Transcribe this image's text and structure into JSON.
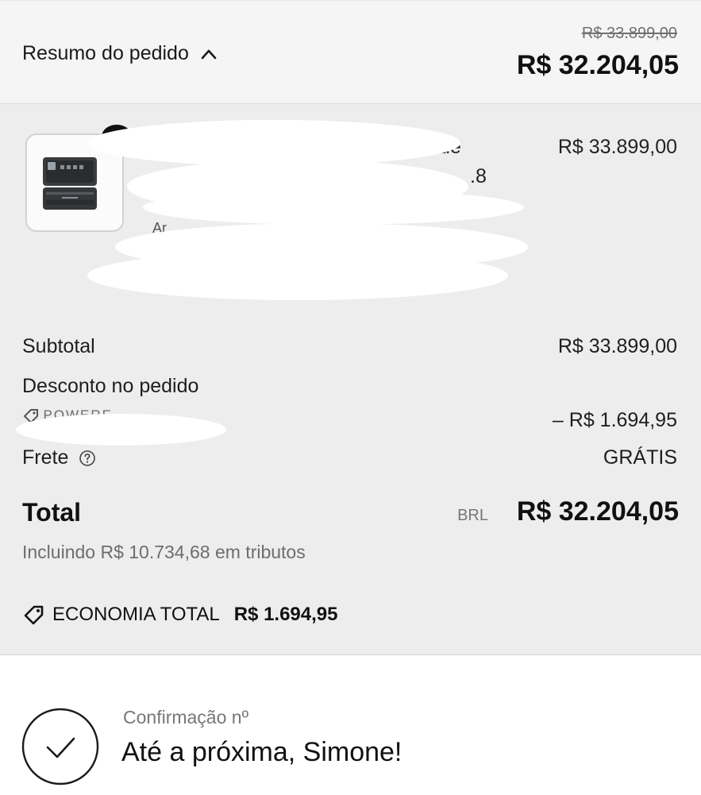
{
  "header": {
    "summary_label": "Resumo do pedido",
    "original_price": "R$ 33.899,00",
    "total_price": "R$ 32.204,05"
  },
  "item": {
    "fragment_1": "de",
    "fragment_2": ".8",
    "fragment_3": "Ar",
    "price": "R$ 33.899,00"
  },
  "summary": {
    "subtotal_label": "Subtotal",
    "subtotal_value": "R$ 33.899,00",
    "discount_label": "Desconto no pedido",
    "discount_code": "POWERE",
    "discount_value": "– R$ 1.694,95",
    "shipping_label": "Frete",
    "shipping_value": "GRÁTIS"
  },
  "total": {
    "label": "Total",
    "currency": "BRL",
    "value": "R$ 32.204,05",
    "tax_note": "Incluindo R$ 10.734,68 em tributos",
    "savings_label": "ECONOMIA TOTAL",
    "savings_value": "R$ 1.694,95"
  },
  "confirmation": {
    "number_label": "Confirmação nº",
    "greeting": "Até a próxima, Simone!"
  },
  "icons": {
    "toggle": "chevron-up-icon",
    "help": "help-circle-icon",
    "tag": "tag-icon",
    "check": "check-circle-icon"
  }
}
